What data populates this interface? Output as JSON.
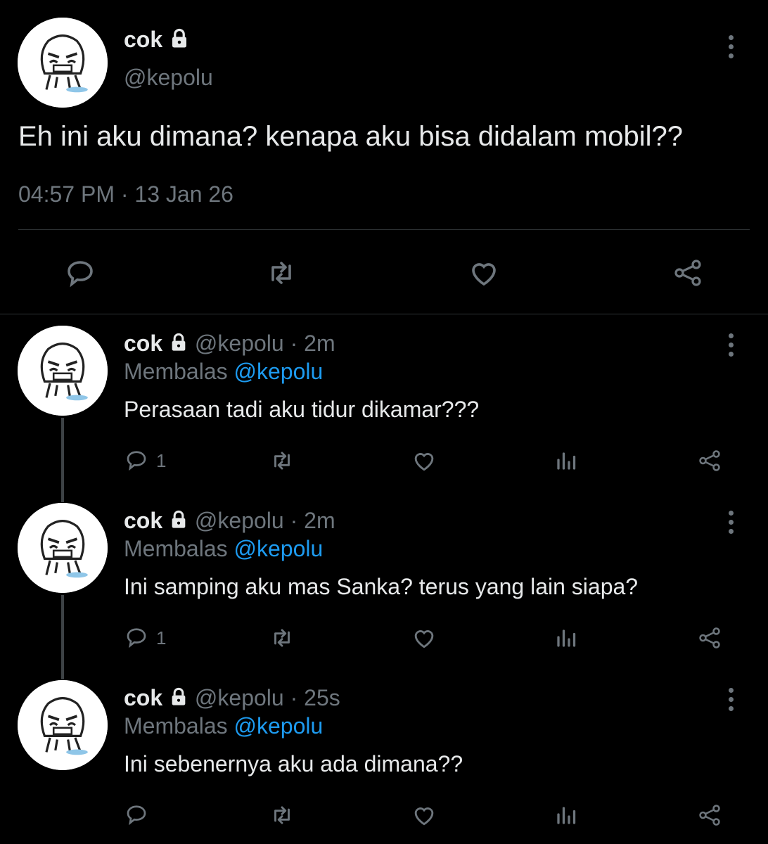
{
  "main_tweet": {
    "display_name": "cok",
    "handle": "@kepolu",
    "text": "Eh ini aku dimana? kenapa aku bisa didalam mobil??",
    "timestamp": "04:57 PM · 13 Jan 26"
  },
  "replies": [
    {
      "display_name": "cok",
      "handle_time": "@kepolu · 2m",
      "replying_label": "Membalas",
      "replying_to": "@kepolu",
      "text": "Perasaan tadi aku tidur dikamar???",
      "reply_count": "1"
    },
    {
      "display_name": "cok",
      "handle_time": "@kepolu · 2m",
      "replying_label": "Membalas",
      "replying_to": "@kepolu",
      "text": "Ini samping aku mas Sanka? terus yang lain siapa?",
      "reply_count": "1"
    },
    {
      "display_name": "cok",
      "handle_time": "@kepolu · 25s",
      "replying_label": "Membalas",
      "replying_to": "@kepolu",
      "text": "Ini sebenernya aku ada dimana??",
      "reply_count": ""
    }
  ],
  "colors": {
    "background": "#000000",
    "text": "#e7e9ea",
    "muted": "#6e767d",
    "accent": "#1d9bf0"
  },
  "icons": [
    "lock-icon",
    "more-icon",
    "reply-icon",
    "retweet-icon",
    "like-icon",
    "share-icon",
    "analytics-icon"
  ]
}
